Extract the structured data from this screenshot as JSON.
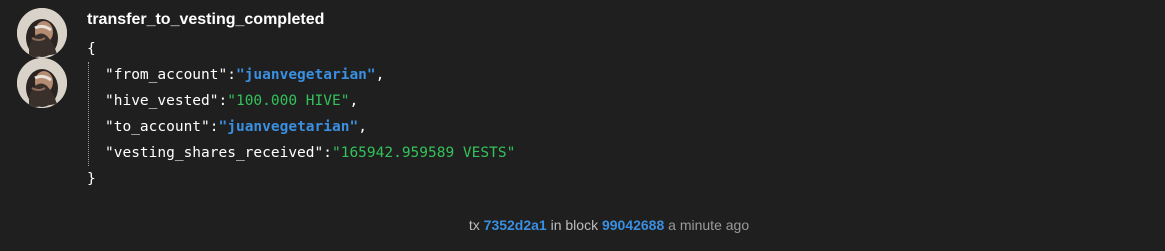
{
  "operation": {
    "title": "transfer_to_vesting_completed",
    "open_brace": "{",
    "close_brace": "}",
    "fields": [
      {
        "key": "\"from_account\"",
        "sep": ":",
        "value": "\"juanvegetarian\"",
        "comma": ","
      },
      {
        "key": "\"hive_vested\"",
        "sep": ":",
        "value": "\"100.000 HIVE\"",
        "comma": ","
      },
      {
        "key": "\"to_account\"",
        "sep": ":",
        "value": "\"juanvegetarian\"",
        "comma": ","
      },
      {
        "key": "\"vesting_shares_received\"",
        "sep": ":",
        "value": "\"165942.959589 VESTS\"",
        "comma": ""
      }
    ]
  },
  "footer": {
    "tx_label": "tx",
    "tx_id": "7352d2a1",
    "block_label": "in block",
    "block_number": "99042688",
    "time_ago": "a minute ago"
  },
  "colors": {
    "background": "#1f1f1f",
    "account_value": "#3a8fe0",
    "string_value": "#33c25a",
    "link": "#3a8fe0"
  },
  "icons": {
    "avatar": "user-avatar-photo"
  }
}
